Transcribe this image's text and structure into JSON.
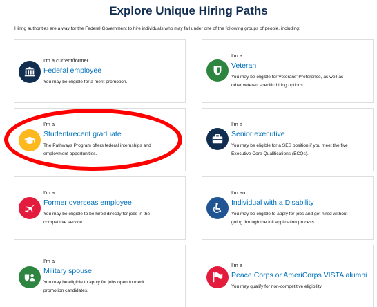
{
  "page": {
    "title": "Explore Unique Hiring Paths",
    "intro": "Hiring authorities are a way for the Federal Government to hire individuals who may fall under one of the following groups of people, including:"
  },
  "cards": [
    {
      "prefix": "I'm a current/former",
      "title": "Federal employee",
      "desc1": "You may be eligible for a merit promotion.",
      "desc2": "",
      "icon": "building-icon",
      "color": "#112e51"
    },
    {
      "prefix": "I'm a",
      "title": "Veteran",
      "desc1": "You may be eligible for Veterans' Preference, as well as",
      "desc2": "other veteran specific hiring options.",
      "icon": "shield-icon",
      "color": "#2e8540"
    },
    {
      "prefix": "I'm a",
      "title": "Student/recent graduate",
      "desc1": "The Pathways Program offers federal internships and",
      "desc2": "employment opportunities.",
      "icon": "graduation-cap-icon",
      "color": "#fdb81e"
    },
    {
      "prefix": "I'm a",
      "title": "Senior executive",
      "desc1": "You may be eligible for a SES position if you meet the five",
      "desc2": "Executive Core Qualifications (ECQs).",
      "icon": "briefcase-icon",
      "color": "#112e51"
    },
    {
      "prefix": "I'm a",
      "title": "Former overseas employee",
      "desc1": "You may be eligible to be hired directly for jobs in the",
      "desc2": "competitive service.",
      "icon": "airplane-icon",
      "color": "#e31c3d"
    },
    {
      "prefix": "I'm an",
      "title": "Individual with a Disability",
      "desc1": "You may be eligible to apply for jobs and get hired without",
      "desc2": "going through the full application process.",
      "icon": "wheelchair-icon",
      "color": "#205493"
    },
    {
      "prefix": "I'm a",
      "title": "Military spouse",
      "desc1": "You may be eligible to apply for jobs open to merit",
      "desc2": "promotion candidates.",
      "icon": "military-spouse-icon",
      "color": "#2e8540"
    },
    {
      "prefix": "I'm a",
      "title": "Peace Corps or AmeriCorps VISTA alumni",
      "desc1": "You may qualify for non-competitive eligibility.",
      "desc2": "",
      "icon": "flag-icon",
      "color": "#e31c3d"
    }
  ]
}
